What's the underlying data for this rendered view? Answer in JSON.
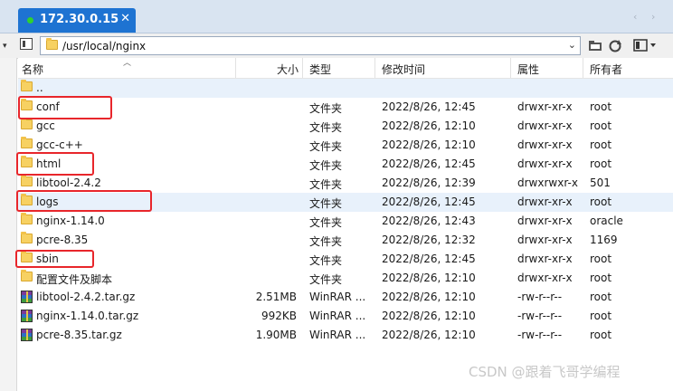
{
  "tab": {
    "title": "172.30.0.15",
    "close": "✕",
    "prev": "‹",
    "next": "›"
  },
  "toolbar": {
    "path": "/usr/local/nginx"
  },
  "columns": {
    "name": "名称",
    "size": "大小",
    "type": "类型",
    "modified": "修改时间",
    "attributes": "属性",
    "owner": "所有者"
  },
  "rows": [
    {
      "icon": "folder",
      "name": "..",
      "size": "",
      "type": "",
      "modified": "",
      "attr": "",
      "owner": ""
    },
    {
      "icon": "folder",
      "name": "conf",
      "size": "",
      "type": "文件夹",
      "modified": "2022/8/26, 12:45",
      "attr": "drwxr-xr-x",
      "owner": "root"
    },
    {
      "icon": "folder",
      "name": "gcc",
      "size": "",
      "type": "文件夹",
      "modified": "2022/8/26, 12:10",
      "attr": "drwxr-xr-x",
      "owner": "root"
    },
    {
      "icon": "folder",
      "name": "gcc-c++",
      "size": "",
      "type": "文件夹",
      "modified": "2022/8/26, 12:10",
      "attr": "drwxr-xr-x",
      "owner": "root"
    },
    {
      "icon": "folder",
      "name": "html",
      "size": "",
      "type": "文件夹",
      "modified": "2022/8/26, 12:45",
      "attr": "drwxr-xr-x",
      "owner": "root"
    },
    {
      "icon": "folder",
      "name": "libtool-2.4.2",
      "size": "",
      "type": "文件夹",
      "modified": "2022/8/26, 12:39",
      "attr": "drwxrwxr-x",
      "owner": "501"
    },
    {
      "icon": "folder",
      "name": "logs",
      "size": "",
      "type": "文件夹",
      "modified": "2022/8/26, 12:45",
      "attr": "drwxr-xr-x",
      "owner": "root"
    },
    {
      "icon": "folder",
      "name": "nginx-1.14.0",
      "size": "",
      "type": "文件夹",
      "modified": "2022/8/26, 12:43",
      "attr": "drwxr-xr-x",
      "owner": "oracle"
    },
    {
      "icon": "folder",
      "name": "pcre-8.35",
      "size": "",
      "type": "文件夹",
      "modified": "2022/8/26, 12:32",
      "attr": "drwxr-xr-x",
      "owner": "1169"
    },
    {
      "icon": "folder",
      "name": "sbin",
      "size": "",
      "type": "文件夹",
      "modified": "2022/8/26, 12:45",
      "attr": "drwxr-xr-x",
      "owner": "root"
    },
    {
      "icon": "folder",
      "name": "配置文件及脚本",
      "size": "",
      "type": "文件夹",
      "modified": "2022/8/26, 12:10",
      "attr": "drwxr-xr-x",
      "owner": "root"
    },
    {
      "icon": "rar",
      "name": "libtool-2.4.2.tar.gz",
      "size": "2.51MB",
      "type": "WinRAR ...",
      "modified": "2022/8/26, 12:10",
      "attr": "-rw-r--r--",
      "owner": "root"
    },
    {
      "icon": "rar",
      "name": "nginx-1.14.0.tar.gz",
      "size": "992KB",
      "type": "WinRAR ...",
      "modified": "2022/8/26, 12:10",
      "attr": "-rw-r--r--",
      "owner": "root"
    },
    {
      "icon": "rar",
      "name": "pcre-8.35.tar.gz",
      "size": "1.90MB",
      "type": "WinRAR ...",
      "modified": "2022/8/26, 12:10",
      "attr": "-rw-r--r--",
      "owner": "root"
    }
  ],
  "watermark": "CSDN @跟着飞哥学编程",
  "colors": {
    "tab_active": "#1e73d2",
    "highlight": "#e8262b",
    "selected_row": "#e8f1fb"
  },
  "icons": [
    "folder-icon",
    "rar-archive-icon",
    "refresh-icon",
    "open-folder-icon",
    "view-mode-icon"
  ]
}
